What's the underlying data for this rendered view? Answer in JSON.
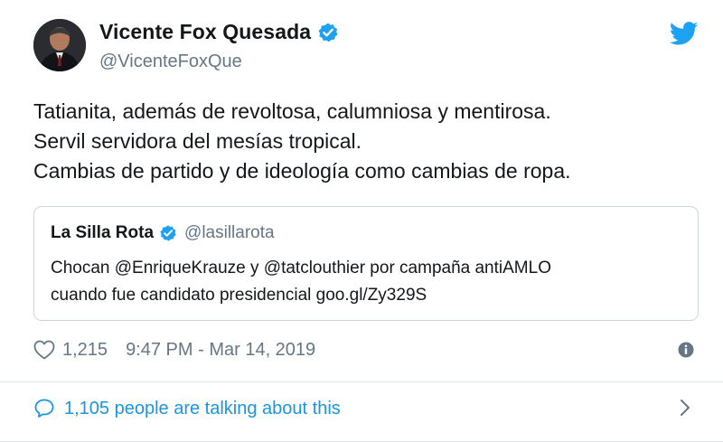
{
  "author": {
    "display_name": "Vicente Fox Quesada",
    "handle": "@VicenteFoxQue",
    "avatar_icon": "avatar-photo",
    "verified_icon": "verified-badge-icon"
  },
  "brand": {
    "icon": "twitter-bird-icon",
    "color": "#1da1f2"
  },
  "tweet": {
    "lines": [
      "Tatianita, además de revoltosa, calumniosa y mentirosa.",
      "Servil servidora del mesías tropical.",
      "Cambias de partido y de ideología como cambias de ropa."
    ]
  },
  "quoted": {
    "display_name": "La Silla Rota",
    "handle": "@lasillarota",
    "lines": [
      "Chocan @EnriqueKrauze y @tatclouthier por campaña antiAMLO",
      "cuando fue candidato presidencial goo.gl/Zy329S"
    ]
  },
  "meta": {
    "likes": "1,215",
    "timestamp": "9:47 PM - Mar 14, 2019",
    "like_icon": "heart-icon",
    "info_icon": "info-icon"
  },
  "conversation": {
    "label": "1,105 people are talking about this",
    "icon": "speech-bubble-icon",
    "chevron_icon": "chevron-right-icon",
    "color": "#1b95e0"
  },
  "colors": {
    "text": "#14171a",
    "secondary": "#657786",
    "border": "#ccd6dd",
    "verified": "#1da1f2"
  }
}
